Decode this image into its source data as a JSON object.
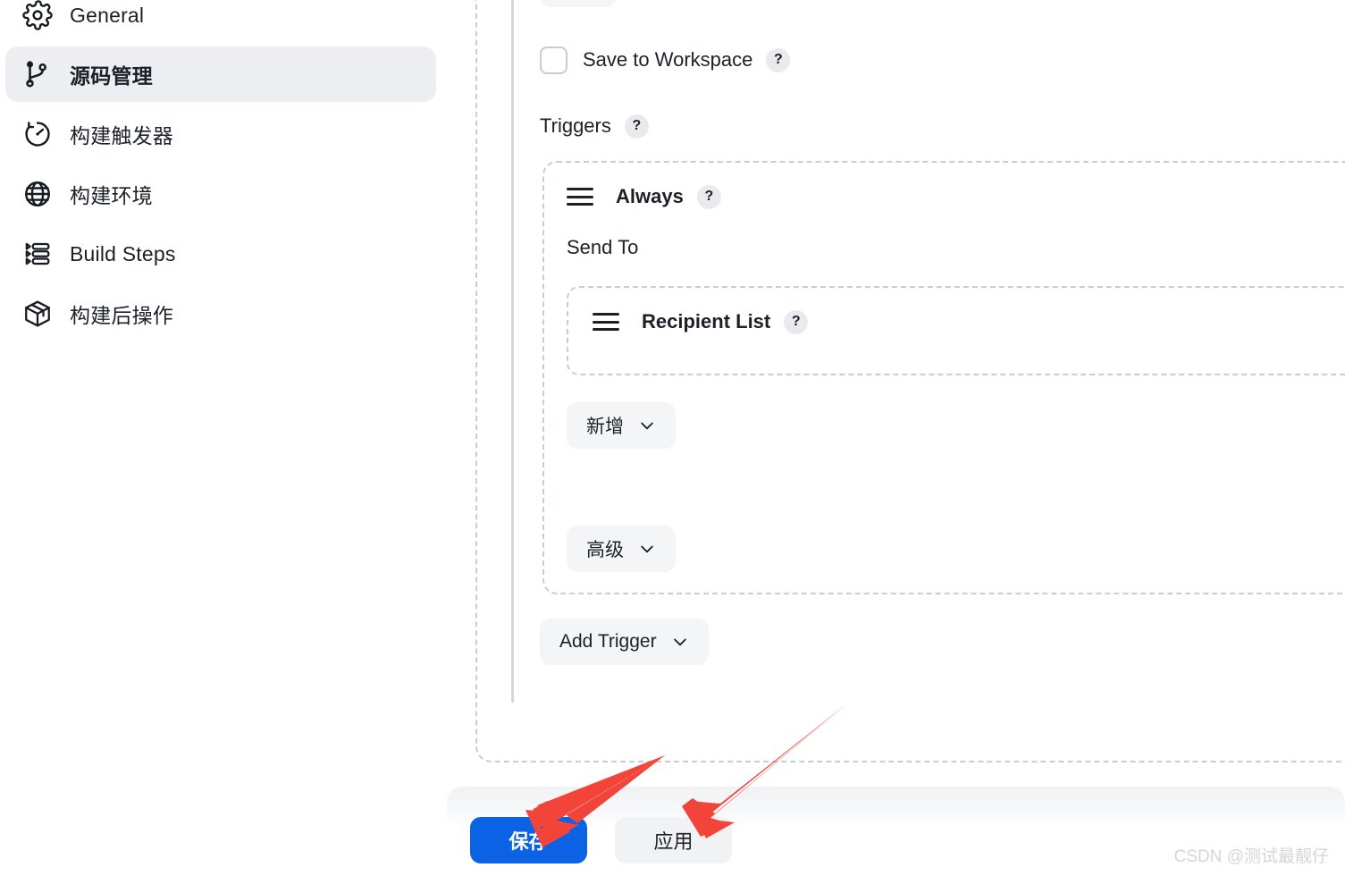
{
  "sidebar": {
    "items": [
      {
        "label": "General",
        "icon": "gear-icon",
        "active": false
      },
      {
        "label": "源码管理",
        "icon": "git-branch-icon",
        "active": true
      },
      {
        "label": "构建触发器",
        "icon": "timer-icon",
        "active": false
      },
      {
        "label": "构建环境",
        "icon": "globe-icon",
        "active": false
      },
      {
        "label": "Build Steps",
        "icon": "list-steps-icon",
        "active": false
      },
      {
        "label": "构建后操作",
        "icon": "package-icon",
        "active": false
      }
    ]
  },
  "main": {
    "save_to_workspace": {
      "label": "Save to Workspace",
      "help": "?",
      "checked": false
    },
    "triggers": {
      "title": "Triggers",
      "help": "?",
      "always_block": {
        "title": "Always",
        "help": "?",
        "send_to_label": "Send To",
        "recipient_list": {
          "title": "Recipient List",
          "help": "?"
        },
        "add_recipient_button": "新增",
        "advanced_button": "高级"
      },
      "add_trigger_button": "Add Trigger"
    }
  },
  "footer": {
    "save_button": "保存",
    "apply_button": "应用"
  },
  "watermark": "CSDN @测试最靓仔",
  "colors": {
    "primary_blue": "#0b62e4",
    "annotation_red": "#f24438",
    "dashed_border": "#c3ced6",
    "active_nav_bg": "#eceef2",
    "pill_bg": "#f4f5f7",
    "text": "#1c2128"
  }
}
